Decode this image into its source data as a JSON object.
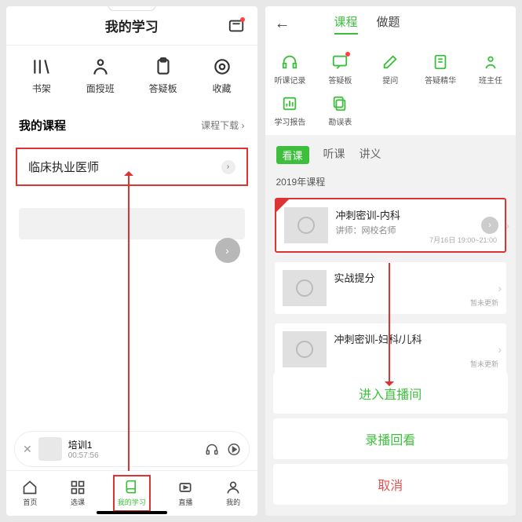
{
  "left": {
    "header_title": "我的学习",
    "quick": [
      {
        "label": "书架",
        "icon": "shelf-icon"
      },
      {
        "label": "面授班",
        "icon": "person-icon"
      },
      {
        "label": "答疑板",
        "icon": "clipboard-icon"
      },
      {
        "label": "收藏",
        "icon": "target-icon"
      }
    ],
    "section_title": "我的课程",
    "section_link": "课程下载",
    "course_name": "临床执业医师",
    "mini_player": {
      "title": "培训1",
      "time": "00:57:56"
    },
    "tabs": [
      {
        "label": "首页",
        "icon": "home-icon"
      },
      {
        "label": "选课",
        "icon": "grid-icon"
      },
      {
        "label": "我的学习",
        "icon": "book-icon",
        "active": true
      },
      {
        "label": "直播",
        "icon": "live-icon"
      },
      {
        "label": "我的",
        "icon": "profile-icon"
      }
    ]
  },
  "right": {
    "tabs": [
      {
        "label": "课程",
        "active": true
      },
      {
        "label": "做题"
      }
    ],
    "icon_grid": [
      {
        "label": "听课记录",
        "icon": "headphone-icon"
      },
      {
        "label": "答疑板",
        "icon": "chat-icon",
        "red_dot": true
      },
      {
        "label": "提问",
        "icon": "edit-icon"
      },
      {
        "label": "答疑精华",
        "icon": "doc-icon"
      },
      {
        "label": "班主任",
        "icon": "teacher-icon"
      },
      {
        "label": "学习报告",
        "icon": "report-icon"
      },
      {
        "label": "勘误表",
        "icon": "copy-icon"
      }
    ],
    "sub_tabs": [
      {
        "label": "看课",
        "active": true
      },
      {
        "label": "听课"
      },
      {
        "label": "讲义"
      }
    ],
    "year_label": "2019年课程",
    "courses": [
      {
        "title": "冲刺密训-内科",
        "teacher": "讲师：网校名师",
        "time": "7月16日 19:00~21:00",
        "highlighted": true,
        "new": true
      },
      {
        "title": "实战提分",
        "teacher": "",
        "time": "暂未更新"
      },
      {
        "title": "冲刺密训-妇科/儿科",
        "teacher": "",
        "time": "暂未更新"
      }
    ],
    "actions": [
      {
        "label": "进入直播间"
      },
      {
        "label": "录播回看"
      },
      {
        "label": "取消",
        "cancel": true
      }
    ]
  }
}
